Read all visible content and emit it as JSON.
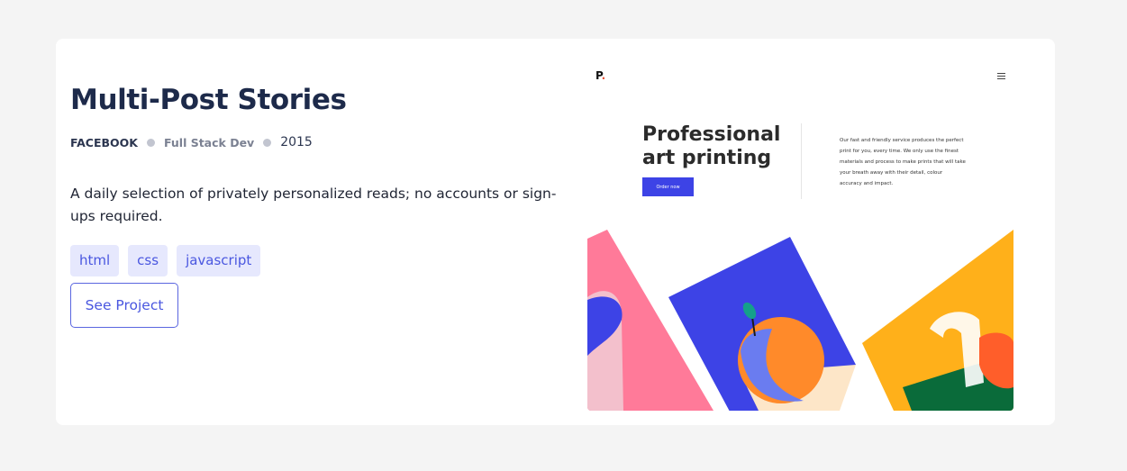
{
  "project": {
    "title": "Multi-Post Stories",
    "client": "FACEBOOK",
    "role": "Full Stack Dev",
    "year": "2015",
    "description": "A daily selection of privately personalized reads; no accounts or sign-ups required.",
    "tags": [
      "html",
      "css",
      "javascript"
    ],
    "cta_label": "See Project"
  },
  "preview": {
    "logo": "P",
    "logo_dot": ".",
    "hero_title_line1": "Professional",
    "hero_title_line2": "art printing",
    "order_label": "Order now",
    "hero_text": "Our fast and friendly service produces the perfect print for you, every time. We only use the finest materials and process to make prints that will take your breath away with their detail, colour accuracy and impact."
  },
  "colors": {
    "page_bg": "#f4f4f4",
    "card_bg": "#ffffff",
    "title": "#1d2a4a",
    "accent": "#4a57e0",
    "tag_bg": "#e6e8fd",
    "art_pink": "#ff7a99",
    "art_blue": "#3d43e6",
    "art_yellow": "#ffb01a",
    "art_green": "#0a6b3a"
  }
}
